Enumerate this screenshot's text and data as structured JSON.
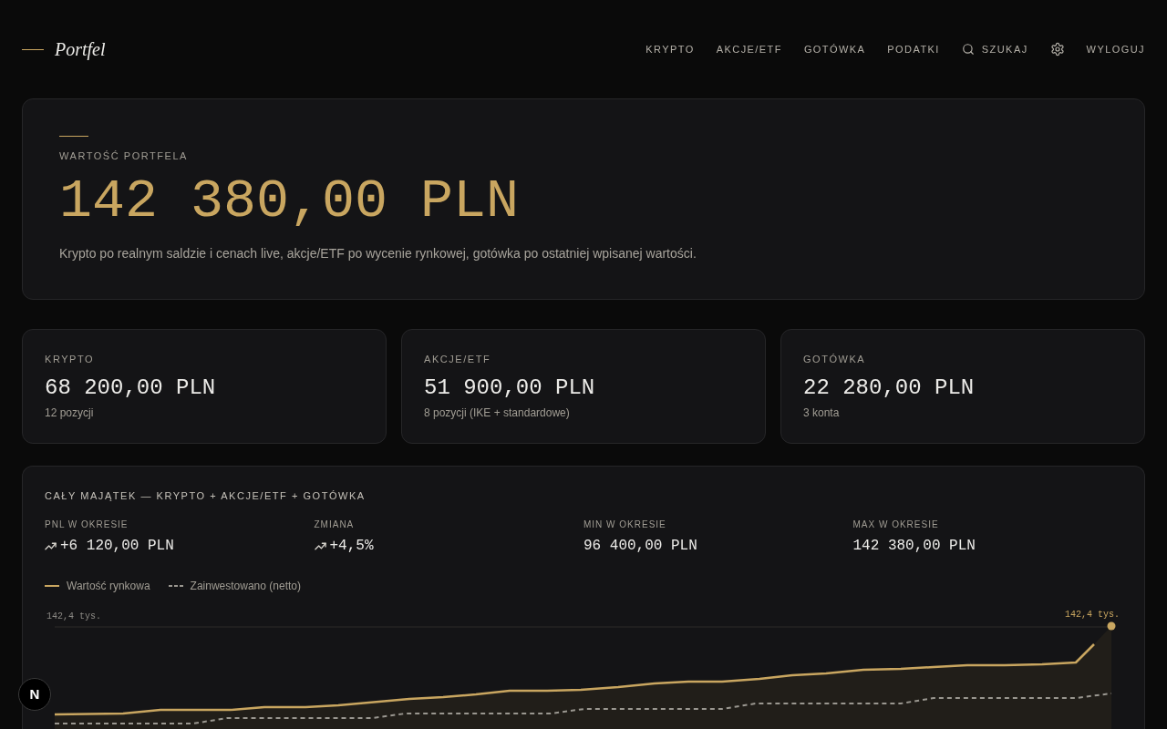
{
  "header": {
    "logo": "Portfel",
    "nav": [
      {
        "kind": "link",
        "label": "KRYPTO"
      },
      {
        "kind": "link",
        "label": "AKCJE/ETF"
      },
      {
        "kind": "link",
        "label": "GOTÓWKA"
      },
      {
        "kind": "link",
        "label": "PODATKI"
      },
      {
        "kind": "search",
        "label": "SZUKAJ"
      },
      {
        "kind": "settings"
      },
      {
        "kind": "link",
        "label": "WYLOGUJ"
      }
    ]
  },
  "summary": {
    "label": "WARTOŚĆ PORTFELA",
    "value": "142 380,00 PLN",
    "description": "Krypto po realnym saldzie i cenach live, akcje/ETF po wycenie rynkowej, gotówka po ostatniej wpisanej wartości."
  },
  "accounts": [
    {
      "label": "KRYPTO",
      "value": "68 200,00 PLN",
      "detail": "12 pozycji"
    },
    {
      "label": "AKCJE/ETF",
      "value": "51 900,00 PLN",
      "detail": "8 pozycji (IKE + standardowe)"
    },
    {
      "label": "GOTÓWKA",
      "value": "22 280,00 PLN",
      "detail": "3 konta"
    }
  ],
  "chart_panel": {
    "title": "CAŁY MAJĄTEK — KRYPTO + AKCJE/ETF + GOTÓWKA",
    "stats": [
      {
        "kind": "rising",
        "label": "PNL W OKRESIE",
        "value": "+6 120,00 PLN"
      },
      {
        "kind": "rising",
        "label": "ZMIANA",
        "value": "+4,5%"
      },
      {
        "kind": "plain",
        "label": "MIN W OKRESIE",
        "value": "96 400,00 PLN"
      },
      {
        "kind": "plain",
        "label": "MAX W OKRESIE",
        "value": "142 380,00 PLN"
      }
    ],
    "legend": [
      {
        "label": "Wartość rynkowa",
        "kind": "solid",
        "color": "#c9a660"
      },
      {
        "label": "Zainwestowano (netto)",
        "kind": "dashed",
        "color": "#9a9790"
      }
    ],
    "chart": {
      "y_tick_label": "142,4 tys.",
      "end_label": "142,4 tys."
    }
  },
  "dev_badge": "N"
}
